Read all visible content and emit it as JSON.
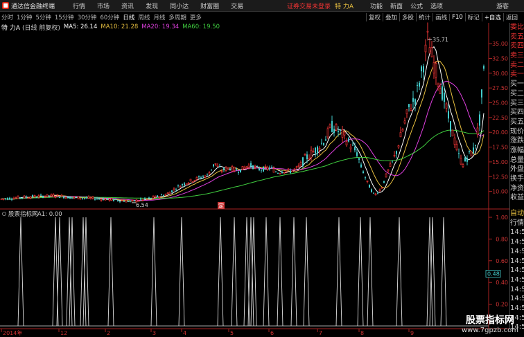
{
  "app": {
    "title": "通达信金融终端",
    "menu": [
      "行情",
      "市场",
      "资讯",
      "发现",
      "同小达",
      "财富圈",
      "交易"
    ],
    "login_status": "证券交易未登录",
    "stock_name": "特 力A",
    "right_links": [
      "功能",
      "新面",
      "公式",
      "选项"
    ],
    "user": "游客"
  },
  "toolbar": {
    "periods": [
      "分时",
      "1分钟",
      "5分钟",
      "15分钟",
      "30分钟",
      "60分钟",
      "日线",
      "周线",
      "月线",
      "多周期",
      "更多"
    ],
    "active_period": "日线",
    "buttons": [
      "复权",
      "叠加",
      "多股",
      "统计",
      "画线",
      "F10",
      "标记",
      "+自选",
      "返回"
    ]
  },
  "info": {
    "stock": "特 力A",
    "mode": "(日线 前复权)",
    "ma5_label": "MA5: 26.14",
    "ma10_label": "MA10: 21.28",
    "ma20_label": "MA20: 19.34",
    "ma60_label": "MA60: 19.50",
    "ma5_color": "#ffffff",
    "ma10_color": "#e8c040",
    "ma20_color": "#e040e0",
    "ma60_color": "#40d040"
  },
  "price_axis": {
    "ticks": [
      "35.00",
      "32.50",
      "30.00",
      "27.50",
      "25.00",
      "22.50",
      "20.00",
      "17.50",
      "15.00",
      "12.50",
      "10.00"
    ]
  },
  "annotations": {
    "high_label": "35.71",
    "low_label": "6.54",
    "marker": "定"
  },
  "indicator": {
    "title": "股票指标网",
    "value_label": "A1: 0.00",
    "axis_ticks": [
      "1.00",
      "0.80",
      "0.60",
      "0.40",
      "0.20"
    ],
    "current_value": "0.48"
  },
  "date_axis": {
    "labels": [
      "2014年",
      "12",
      "2",
      "3",
      "4",
      "5",
      "6",
      "7",
      "8",
      "9"
    ]
  },
  "right_panel": {
    "tabs": [
      "委比",
      "卖五",
      "卖四",
      "卖三",
      "卖二",
      "卖一",
      "买一",
      "买二",
      "买三",
      "买四",
      "买五",
      "现价",
      "涨跌",
      "涨幅",
      "总量",
      "外盘",
      "换手",
      "净资",
      "收益"
    ],
    "lower_tabs": [
      "自动",
      "行情",
      "14:5",
      "14:5",
      "14:5",
      "14:5",
      "14:5",
      "14:5",
      "14:5",
      "14:5",
      "14:5",
      "14:5",
      "14:5"
    ]
  },
  "watermark": {
    "title": "股票指标网",
    "url": "www.7gpzb.com"
  },
  "chart_data": {
    "type": "candlestick",
    "ylim": [
      7.5,
      37
    ],
    "price_points": [
      [
        0,
        8.7
      ],
      [
        30,
        9.0
      ],
      [
        60,
        9.2
      ],
      [
        80,
        9.3
      ],
      [
        100,
        9.0
      ],
      [
        120,
        8.9
      ],
      [
        140,
        8.8
      ],
      [
        160,
        8.6
      ],
      [
        180,
        8.4
      ],
      [
        190,
        8.3
      ],
      [
        200,
        8.5
      ],
      [
        220,
        8.9
      ],
      [
        240,
        9.5
      ],
      [
        260,
        11.0
      ],
      [
        280,
        12.0
      ],
      [
        300,
        12.8
      ],
      [
        310,
        14.8
      ],
      [
        320,
        13.5
      ],
      [
        330,
        14.0
      ],
      [
        345,
        13.5
      ],
      [
        360,
        14.5
      ],
      [
        375,
        13.7
      ],
      [
        390,
        14.0
      ],
      [
        400,
        13.2
      ],
      [
        410,
        13.5
      ],
      [
        420,
        13.4
      ],
      [
        430,
        14.0
      ],
      [
        440,
        15.5
      ],
      [
        450,
        16.5
      ],
      [
        460,
        17.5
      ],
      [
        470,
        19.0
      ],
      [
        478,
        21.0
      ],
      [
        485,
        20.5
      ],
      [
        495,
        19.5
      ],
      [
        505,
        18.0
      ],
      [
        515,
        16.5
      ],
      [
        520,
        14.5
      ],
      [
        530,
        11.5
      ],
      [
        540,
        9.3
      ],
      [
        550,
        10.5
      ],
      [
        560,
        13.5
      ],
      [
        570,
        16.0
      ],
      [
        580,
        20.0
      ],
      [
        590,
        24.0
      ],
      [
        600,
        26.0
      ],
      [
        610,
        31.0
      ],
      [
        617,
        35.7
      ],
      [
        625,
        32.0
      ],
      [
        632,
        29.0
      ],
      [
        640,
        26.0
      ],
      [
        648,
        22.0
      ],
      [
        655,
        19.0
      ],
      [
        662,
        16.0
      ],
      [
        668,
        14.5
      ],
      [
        675,
        16.0
      ],
      [
        684,
        17.0
      ],
      [
        692,
        22.0
      ],
      [
        698,
        30.0
      ]
    ],
    "ma_series": [
      {
        "name": "MA5",
        "values": [
          26.14
        ]
      },
      {
        "name": "MA10",
        "values": [
          21.28
        ]
      },
      {
        "name": "MA20",
        "values": [
          19.34
        ]
      },
      {
        "name": "MA60",
        "values": [
          19.5
        ]
      }
    ],
    "indicator_spikes_x": [
      30,
      80,
      86,
      100,
      104,
      120,
      124,
      160,
      222,
      262,
      318,
      338,
      356,
      362,
      366,
      384,
      404,
      424,
      442,
      489,
      520,
      534,
      576,
      620,
      624,
      640
    ]
  }
}
